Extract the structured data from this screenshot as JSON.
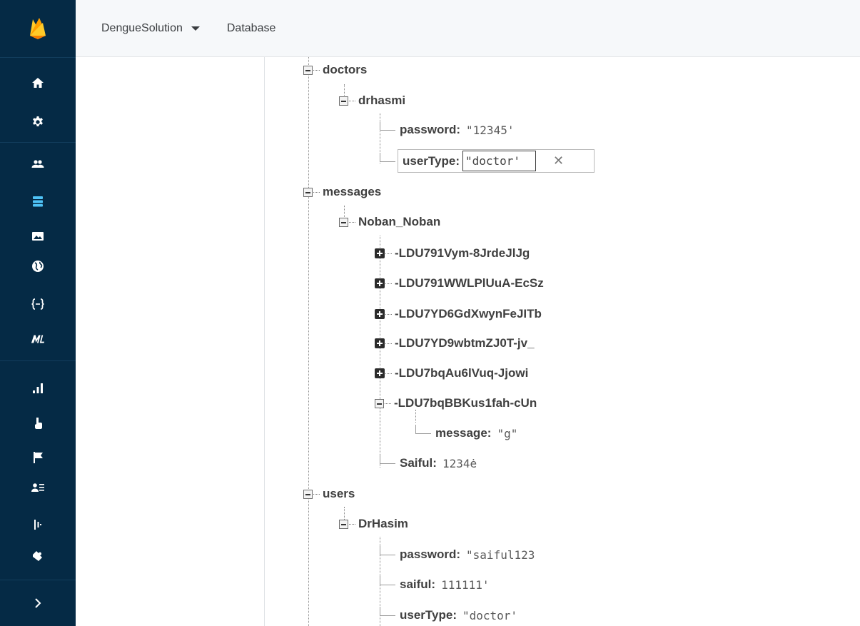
{
  "header": {
    "project_name": "DengueSolution",
    "section": "Database"
  },
  "sidebar": {
    "items": [
      {
        "icon": "home-icon"
      },
      {
        "icon": "settings-gear-icon"
      },
      {
        "icon": "authentication-users-icon"
      },
      {
        "icon": "database-icon",
        "active": true
      },
      {
        "icon": "storage-image-icon"
      },
      {
        "icon": "hosting-globe-icon"
      },
      {
        "icon": "functions-braces-icon"
      },
      {
        "icon": "ml-kit-icon"
      },
      {
        "icon": "analytics-bars-icon"
      },
      {
        "icon": "predictions-icon"
      },
      {
        "icon": "events-flag-icon"
      },
      {
        "icon": "audiences-icon"
      },
      {
        "icon": "ab-testing-icon"
      },
      {
        "icon": "extensions-icon"
      }
    ],
    "accent_color": "#4fc3f7",
    "background_color": "#052a45"
  },
  "tree": {
    "doctors": {
      "key": "doctors",
      "drhasmi": {
        "key": "drhasmi",
        "password_key": "password:",
        "password_value": "\"12345'",
        "usertype_key": "userType:",
        "usertype_value": "\"doctor'"
      }
    },
    "messages": {
      "key": "messages",
      "noban": {
        "key": "Noban_Noban",
        "children": [
          "-LDU791Vym-8JrdeJlJg",
          "-LDU791WWLPlUuA-EcSz",
          "-LDU7YD6GdXwynFeJITb",
          "-LDU7YD9wbtmZJ0T-jv_",
          "-LDU7bqAu6lVuq-Jjowi",
          "-LDU7bqBBKus1fah-cUn"
        ],
        "message_key": "message:",
        "message_value": "\"g\"",
        "saiful_key": "Saiful:",
        "saiful_value": "1234ė"
      }
    },
    "users": {
      "key": "users",
      "drhasim": {
        "key": "DrHasim",
        "password_key": "password:",
        "password_value": "\"saiful123",
        "saiful_key": "saiful:",
        "saiful_value": "111111'",
        "usertype_key": "userType:",
        "usertype_value": "\"doctor'"
      }
    }
  }
}
